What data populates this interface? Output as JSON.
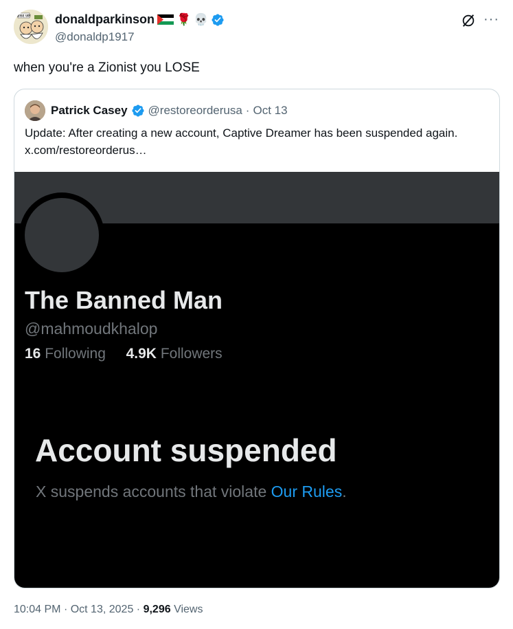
{
  "tweet": {
    "author_name": "donaldparkinson",
    "author_handle": "@donaldp1917",
    "avatar_badge_text": "WISE UP!",
    "emojis": [
      "🌹",
      "💀"
    ],
    "text": "when you're a Zionist you LOSE",
    "time": "10:04 PM",
    "sep1": "·",
    "date": "Oct 13, 2025",
    "sep2": "·",
    "views_count": "9,296",
    "views_label": "Views",
    "more_icon": "···"
  },
  "quote": {
    "author_name": "Patrick Casey",
    "author_handle": "@restoreorderusa",
    "sep": "·",
    "date": "Oct 13",
    "text": "Update: After creating a new account, Captive Dreamer has been suspended again.  x.com/restoreorderus…",
    "media": {
      "profile_name": "The Banned Man",
      "profile_handle": "@mahmoudkhalop",
      "following_count": "16",
      "following_label": "Following",
      "followers_count": "4.9K",
      "followers_label": "Followers",
      "suspended_title": "Account suspended",
      "suspended_desc": "X suspends accounts that violate ",
      "suspended_link": "Our Rules",
      "suspended_end": "."
    }
  },
  "colors": {
    "accent": "#1d9bf0",
    "text_primary": "#0f1419",
    "text_secondary": "#536471",
    "dark_bg": "#000000",
    "banner": "#333639"
  }
}
